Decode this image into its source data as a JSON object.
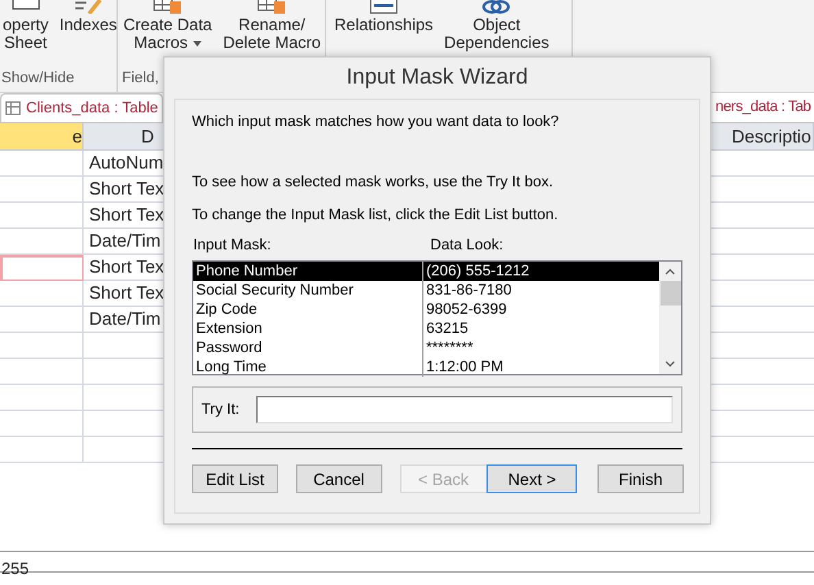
{
  "ribbon": {
    "groups": [
      {
        "label": "Show/Hide",
        "buttons": [
          {
            "lines": [
              "operty",
              "Sheet"
            ],
            "dropdown": false
          },
          {
            "lines": [
              "Indexes"
            ],
            "dropdown": false
          }
        ]
      },
      {
        "label": "Field,",
        "buttons": [
          {
            "lines": [
              "Create Data",
              "Macros"
            ],
            "dropdown": true
          },
          {
            "lines": [
              "Rename/",
              "Delete Macro"
            ],
            "dropdown": false
          }
        ]
      },
      {
        "buttons": [
          {
            "lines": [
              "Relationships"
            ],
            "dropdown": false
          },
          {
            "lines": [
              "Object",
              "Dependencies"
            ],
            "dropdown": false
          }
        ]
      }
    ]
  },
  "tabs": [
    {
      "label": "Clients_data : Table",
      "selected": true
    },
    {
      "label": "ners_data : Tab",
      "selected": false
    }
  ],
  "table": {
    "columns": [
      {
        "label": "e",
        "selected": true
      },
      {
        "label": "D",
        "selected": false
      },
      {
        "label": "Descriptio",
        "selected": false
      }
    ],
    "rows": [
      {
        "data_type": "AutoNum",
        "selected": false
      },
      {
        "data_type": "Short Tex",
        "selected": false
      },
      {
        "data_type": "Short Tex",
        "selected": false
      },
      {
        "data_type": "Date/Tim",
        "selected": false
      },
      {
        "data_type": "Short Tex",
        "selected": true
      },
      {
        "data_type": "Short Tex",
        "selected": false
      },
      {
        "data_type": "Date/Tim",
        "selected": false
      }
    ]
  },
  "field_properties": {
    "value": "255"
  },
  "dialog": {
    "title": "Input Mask Wizard",
    "question": "Which input mask matches how you want data to look?",
    "hints": [
      "To see how a selected mask works, use the Try It box.",
      "To change the Input Mask list, click the Edit List button."
    ],
    "list_headers": [
      "Input Mask:",
      "Data Look:"
    ],
    "masks": [
      {
        "name": "Phone Number",
        "look": "(206) 555-1212",
        "selected": true
      },
      {
        "name": "Social Security Number",
        "look": "831-86-7180",
        "selected": false
      },
      {
        "name": "Zip Code",
        "look": "98052-6399",
        "selected": false
      },
      {
        "name": "Extension",
        "look": "63215",
        "selected": false
      },
      {
        "name": "Password",
        "look": "********",
        "selected": false
      },
      {
        "name": "Long Time",
        "look": "1:12:00 PM",
        "selected": false
      }
    ],
    "try_it": {
      "label": "Try It:"
    },
    "buttons": [
      {
        "label": "Edit List",
        "disabled": false,
        "default": false
      },
      {
        "label": "Cancel",
        "disabled": false,
        "default": false
      },
      {
        "label": "< Back",
        "disabled": true,
        "default": false
      },
      {
        "label": "Next >",
        "disabled": false,
        "default": true
      },
      {
        "label": "Finish",
        "disabled": false,
        "default": false
      }
    ]
  }
}
